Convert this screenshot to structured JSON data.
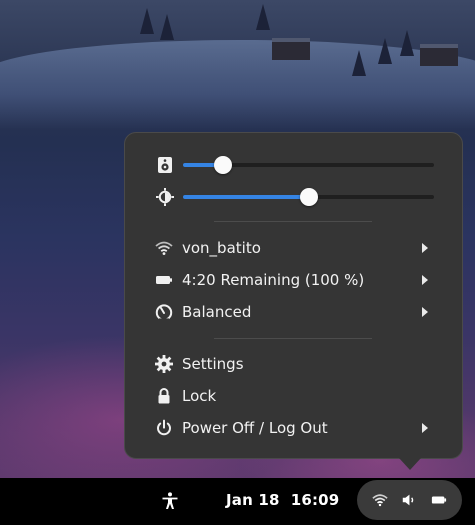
{
  "panel": {
    "date": "Jan 18",
    "time": "16:09",
    "status_icons": [
      "wifi-icon",
      "volume-icon",
      "battery-icon"
    ],
    "accessibility_icon": "accessibility-icon"
  },
  "menu": {
    "volume": {
      "icon": "speaker-icon",
      "level": 0.16
    },
    "brightness": {
      "icon": "brightness-icon",
      "level": 0.5
    },
    "wifi": {
      "label": "von_batito",
      "icon": "wifi-icon"
    },
    "battery": {
      "label": "4:20 Remaining (100 %)",
      "icon": "battery-icon"
    },
    "power_mode": {
      "label": "Balanced",
      "icon": "power-mode-icon"
    },
    "settings": {
      "label": "Settings",
      "icon": "gear-icon"
    },
    "lock": {
      "label": "Lock",
      "icon": "lock-icon"
    },
    "power_off": {
      "label": "Power Off / Log Out",
      "icon": "power-icon"
    }
  },
  "colors": {
    "accent": "#3584e4",
    "popup_bg": "#353535",
    "panel_bg": "#000000"
  }
}
